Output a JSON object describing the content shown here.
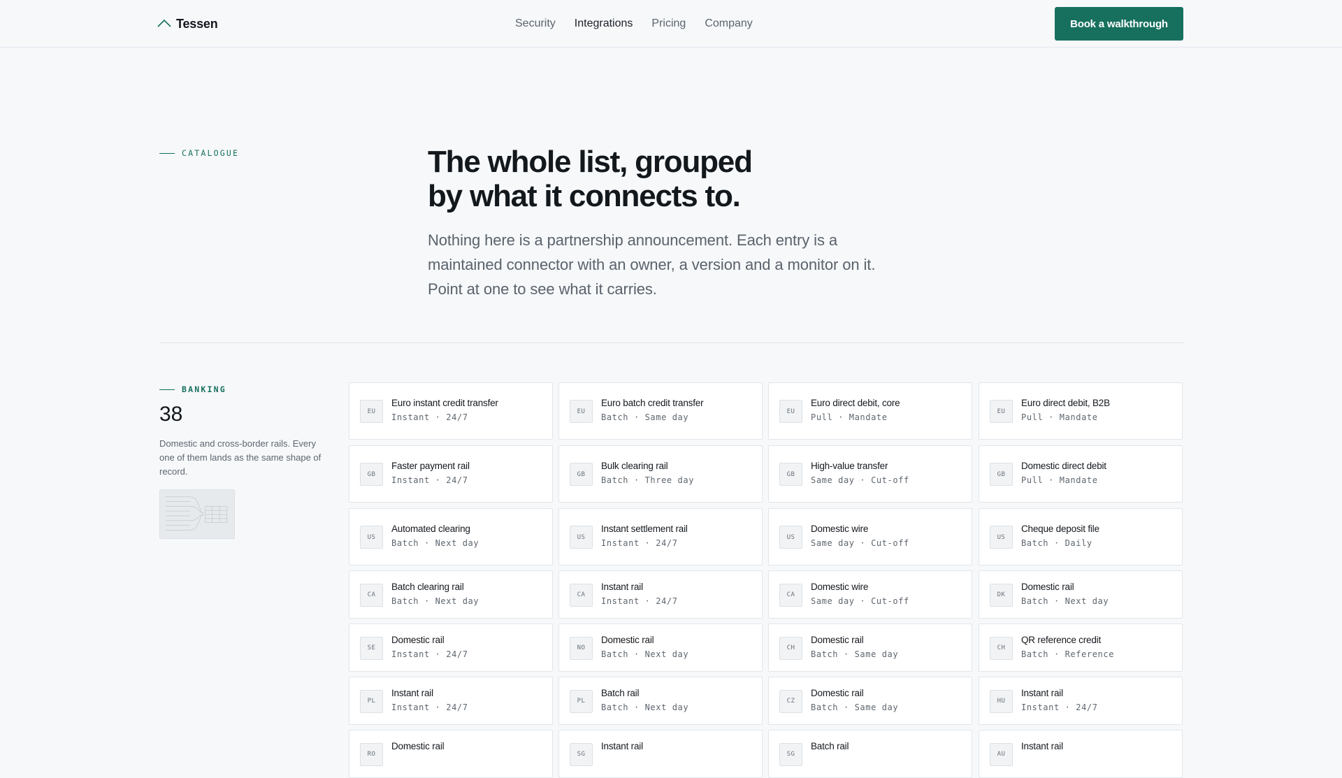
{
  "header": {
    "brand": "Tessen",
    "nav": [
      "Security",
      "Integrations",
      "Pricing",
      "Company"
    ],
    "active_nav": "Integrations",
    "cta_label": "Book a walkthrough"
  },
  "hero": {
    "eyebrow": "CATALOGUE",
    "title_line1": "The whole list, grouped",
    "title_line2": "by what it connects to.",
    "lede": "Nothing here is a partnership announcement. Each entry is a maintained connector with an owner, a version and a monitor on it. Point at one to see what it carries."
  },
  "section": {
    "eyebrow": "BANKING",
    "count": "38",
    "description": "Domestic and cross-border rails. Every one of them lands as the same shape of record."
  },
  "colors": {
    "accent": "#17705e",
    "background": "#f6f8fa",
    "card_background": "#ffffff",
    "border": "#e2e6ea"
  },
  "connectors": [
    {
      "code": "EU",
      "title": "Euro instant credit transfer",
      "meta": "Instant · 24/7"
    },
    {
      "code": "EU",
      "title": "Euro batch credit transfer",
      "meta": "Batch · Same day"
    },
    {
      "code": "EU",
      "title": "Euro direct debit, core",
      "meta": "Pull · Mandate"
    },
    {
      "code": "EU",
      "title": "Euro direct debit, B2B",
      "meta": "Pull · Mandate"
    },
    {
      "code": "GB",
      "title": "Faster payment rail",
      "meta": "Instant · 24/7"
    },
    {
      "code": "GB",
      "title": "Bulk clearing rail",
      "meta": "Batch · Three day"
    },
    {
      "code": "GB",
      "title": "High-value transfer",
      "meta": "Same day · Cut-off"
    },
    {
      "code": "GB",
      "title": "Domestic direct debit",
      "meta": "Pull · Mandate"
    },
    {
      "code": "US",
      "title": "Automated clearing",
      "meta": "Batch · Next day"
    },
    {
      "code": "US",
      "title": "Instant settlement rail",
      "meta": "Instant · 24/7"
    },
    {
      "code": "US",
      "title": "Domestic wire",
      "meta": "Same day · Cut-off"
    },
    {
      "code": "US",
      "title": "Cheque deposit file",
      "meta": "Batch · Daily"
    },
    {
      "code": "CA",
      "title": "Batch clearing rail",
      "meta": "Batch · Next day"
    },
    {
      "code": "CA",
      "title": "Instant rail",
      "meta": "Instant · 24/7"
    },
    {
      "code": "CA",
      "title": "Domestic wire",
      "meta": "Same day · Cut-off"
    },
    {
      "code": "DK",
      "title": "Domestic rail",
      "meta": "Batch · Next day"
    },
    {
      "code": "SE",
      "title": "Domestic rail",
      "meta": "Instant · 24/7"
    },
    {
      "code": "NO",
      "title": "Domestic rail",
      "meta": "Batch · Next day"
    },
    {
      "code": "CH",
      "title": "Domestic rail",
      "meta": "Batch · Same day"
    },
    {
      "code": "CH",
      "title": "QR reference credit",
      "meta": "Batch · Reference"
    },
    {
      "code": "PL",
      "title": "Instant rail",
      "meta": "Instant · 24/7"
    },
    {
      "code": "PL",
      "title": "Batch rail",
      "meta": "Batch · Next day"
    },
    {
      "code": "CZ",
      "title": "Domestic rail",
      "meta": "Batch · Same day"
    },
    {
      "code": "HU",
      "title": "Instant rail",
      "meta": "Instant · 24/7"
    },
    {
      "code": "RO",
      "title": "Domestic rail",
      "meta": ""
    },
    {
      "code": "SG",
      "title": "Instant rail",
      "meta": ""
    },
    {
      "code": "SG",
      "title": "Batch rail",
      "meta": ""
    },
    {
      "code": "AU",
      "title": "Instant rail",
      "meta": ""
    }
  ]
}
